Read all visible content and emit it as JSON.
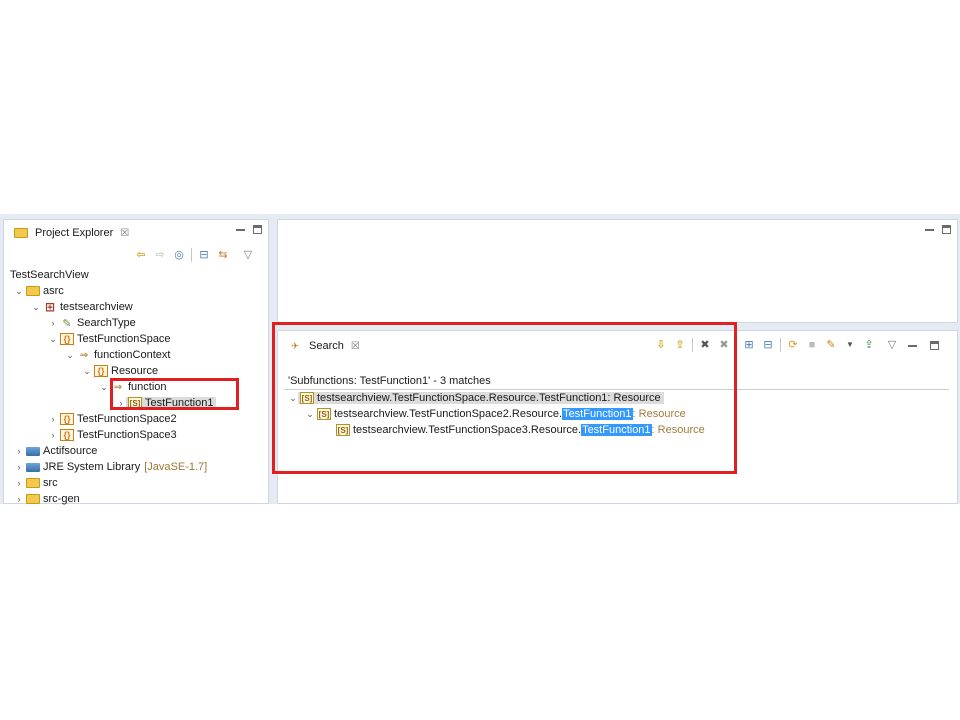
{
  "project_explorer": {
    "title": "Project Explorer",
    "close": "☒",
    "workspace": "TestSearchView",
    "tree": [
      {
        "label": "asrc",
        "icon": "source-folder-icon",
        "expanded": true
      },
      {
        "label": "testsearchview",
        "icon": "package-icon",
        "expanded": true
      },
      {
        "label": "SearchType",
        "icon": "search-type-icon",
        "expanded": false
      },
      {
        "label": "TestFunctionSpace",
        "icon": "function-space-icon",
        "expanded": true
      },
      {
        "label": "functionContext",
        "icon": "context-icon",
        "expanded": true
      },
      {
        "label": "Resource",
        "icon": "function-space-icon",
        "expanded": true
      },
      {
        "label": "function",
        "icon": "folder-icon",
        "expanded": true
      },
      {
        "label": "TestFunction1",
        "icon": "function-s-icon",
        "expanded": false,
        "selected": true
      },
      {
        "label": "TestFunctionSpace2",
        "icon": "function-space-icon",
        "expanded": false
      },
      {
        "label": "TestFunctionSpace3",
        "icon": "function-space-icon",
        "expanded": false
      },
      {
        "label": "Actifsource",
        "icon": "library-icon",
        "expanded": false
      },
      {
        "label": "JRE System Library",
        "decoration": "[JavaSE-1.7]",
        "icon": "library-icon",
        "expanded": false
      },
      {
        "label": "src",
        "icon": "source-folder-icon",
        "expanded": false
      },
      {
        "label": "src-gen",
        "icon": "source-folder-icon",
        "expanded": false
      }
    ]
  },
  "search_view": {
    "title": "Search",
    "close": "☒",
    "summary": "'Subfunctions: TestFunction1' - 3 matches",
    "results": [
      {
        "prefix": "testsearchview.TestFunctionSpace.Resource.TestFunction1: Resource",
        "match": "",
        "suffix": ""
      },
      {
        "prefix": "testsearchview.TestFunctionSpace2.Resource.",
        "match": "TestFunction1",
        "suffix": ": Resource"
      },
      {
        "prefix": "testsearchview.TestFunctionSpace3.Resource.",
        "match": "TestFunction1",
        "suffix": ": Resource"
      }
    ]
  },
  "icons": {
    "expanded": "⌄",
    "collapsed": "›",
    "s_icon": "[S]",
    "curly_icon": "{}",
    "back": "⇦",
    "forward": "⇨",
    "down": "⇩",
    "up": "⇧",
    "remove": "✖",
    "menu": "▽"
  },
  "colors": {
    "highlight": "#3399ff",
    "annotation_box": "#e02020",
    "resource_text": "#a07c3a"
  }
}
